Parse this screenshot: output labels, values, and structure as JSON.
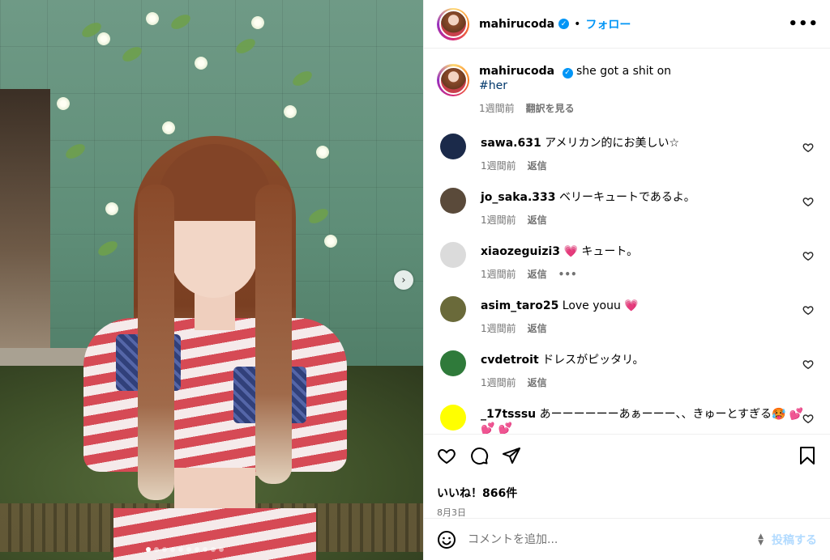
{
  "post": {
    "username": "mahirucoda",
    "follow_label": "フォロー",
    "separator": "•",
    "more_label": "•••"
  },
  "caption": {
    "username": "mahirucoda",
    "text": "she got a shit on",
    "hashtag": "#her",
    "time": "1週間前",
    "translate_label": "翻訳を見る"
  },
  "comments": [
    {
      "username": "sawa.631",
      "text": "アメリカン的にお美しい☆",
      "time": "1週間前",
      "reply_label": "返信",
      "avatar_color": "#1b2a4a"
    },
    {
      "username": "jo_saka.333",
      "text": "ベリーキュートであるよ。",
      "time": "1週間前",
      "reply_label": "返信",
      "avatar_color": "#5a4a3a"
    },
    {
      "username": "xiaozeguizi3",
      "text": "💗 キュート。",
      "time": "1週間前",
      "reply_label": "返信",
      "avatar_color": "#dbdbdb",
      "more_label": "•••"
    },
    {
      "username": "asim_taro25",
      "text": "Love youu 💗",
      "time": "1週間前",
      "reply_label": "返信",
      "avatar_color": "#6a6a3a"
    },
    {
      "username": "cvdetroit",
      "text": "ドレスがピッタリ。",
      "time": "1週間前",
      "reply_label": "返信",
      "avatar_color": "#2f7a3a"
    },
    {
      "username": "_17tsssu",
      "text": "あーーーーーーあぁーーー、、きゅーとすぎる🥵 💕 💕 💕",
      "time": "",
      "reply_label": "",
      "avatar_color": "#ffff00"
    }
  ],
  "engagement": {
    "likes_label": "いいね！866件",
    "date": "8月3日"
  },
  "compose": {
    "placeholder": "コメントを追加...",
    "post_label": "投稿する"
  },
  "carousel": {
    "next_glyph": "›",
    "slide_count": 10,
    "active_index": 0
  },
  "icons": [
    "more-options-icon",
    "verified-badge-icon",
    "heart-icon",
    "comment-icon",
    "share-icon",
    "bookmark-icon",
    "emoji-icon",
    "chevron-right-icon"
  ],
  "colors": {
    "link_blue": "#0095f6",
    "hashtag": "#00376b",
    "muted": "#737373",
    "post_disabled": "#b3dbff"
  }
}
